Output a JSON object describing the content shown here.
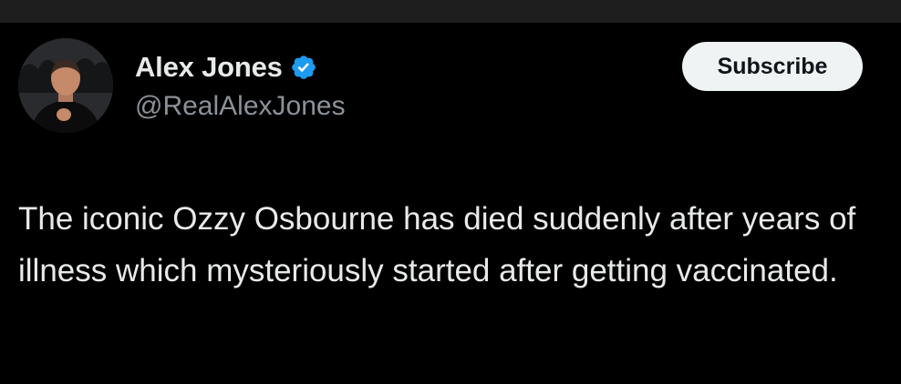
{
  "post": {
    "author": {
      "display_name": "Alex Jones",
      "handle": "@RealAlexJones",
      "verified_icon": "verified-badge-icon"
    },
    "subscribe_label": "Subscribe",
    "text": "The iconic Ozzy Osbourne has died suddenly after years of illness which mysteriously started after getting vaccinated."
  },
  "colors": {
    "background": "#000000",
    "text_primary": "#e7e9ea",
    "text_secondary": "#8b9197",
    "verified_blue": "#1d9bf0",
    "button_bg": "#eff3f4",
    "button_text": "#0f1419"
  }
}
